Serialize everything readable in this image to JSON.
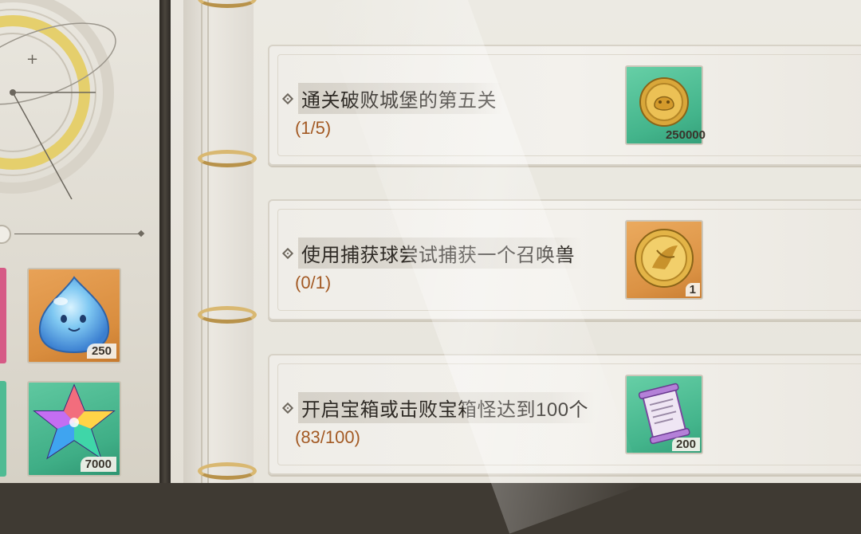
{
  "left_panel": {
    "slots": [
      {
        "icon": "blue-slime-icon",
        "count": "250"
      },
      {
        "icon": "rainbow-crystal-icon",
        "count": "7000"
      }
    ]
  },
  "tasks": [
    {
      "title": "通关破败城堡的第五关",
      "progress": "(1/5)",
      "reward": {
        "icon": "gold-coin-icon",
        "quantity": "250000",
        "bg": "green"
      }
    },
    {
      "title": "使用捕获球尝试捕获一个召唤兽",
      "progress": "(0/1)",
      "reward": {
        "icon": "golden-medal-icon",
        "quantity": "1",
        "bg": "orange"
      }
    },
    {
      "title": "开启宝箱或击败宝箱怪达到100个",
      "progress": "(83/100)",
      "reward": {
        "icon": "purple-scroll-icon",
        "quantity": "200",
        "bg": "green"
      }
    }
  ],
  "colors": {
    "progress_text": "#a35a24",
    "title_text": "#2e2a25",
    "ring_gold": "#d9b871"
  }
}
